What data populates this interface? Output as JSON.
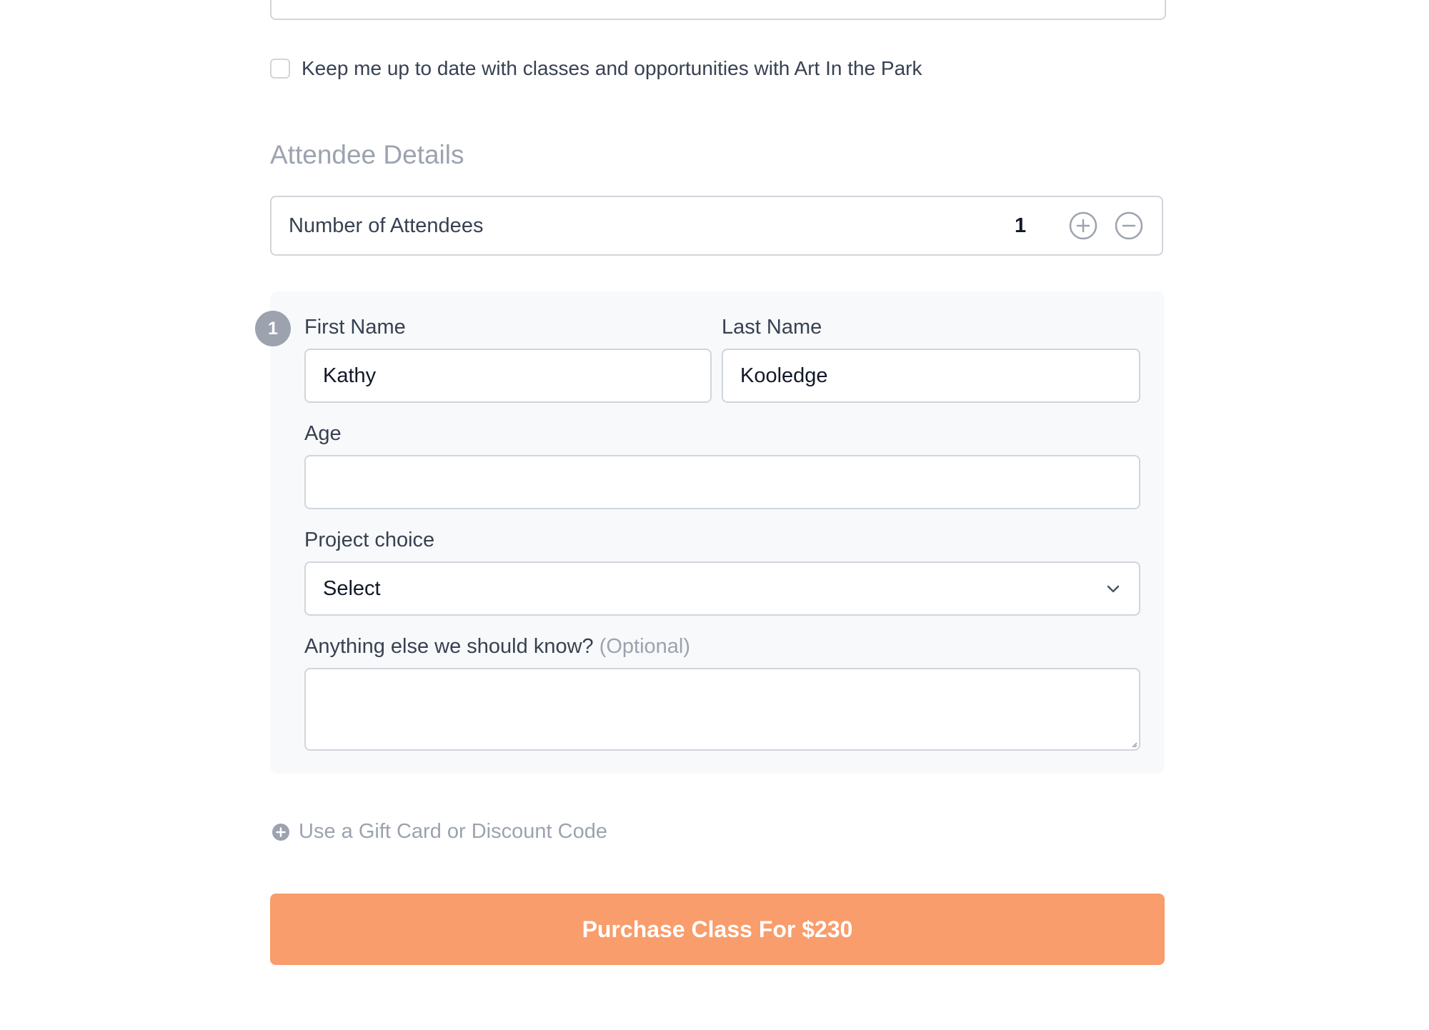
{
  "newsletter": {
    "label": "Keep me up to date with classes and opportunities with Art In the Park",
    "checked": false
  },
  "attendee_section": {
    "title": "Attendee Details",
    "count_label": "Number of Attendees",
    "count_value": "1",
    "increment_icon": "plus-circle-icon",
    "decrement_icon": "minus-circle-icon"
  },
  "attendee": {
    "number": "1",
    "first_name_label": "First Name",
    "first_name_value": "Kathy",
    "last_name_label": "Last Name",
    "last_name_value": "Kooledge",
    "age_label": "Age",
    "age_value": "",
    "project_label": "Project choice",
    "project_value": "Select",
    "notes_label": "Anything else we should know?",
    "notes_optional": "(Optional)",
    "notes_value": ""
  },
  "gift_card": {
    "label": "Use a Gift Card or Discount Code",
    "icon": "plus-circle-filled-icon"
  },
  "purchase": {
    "label": "Purchase Class For $230"
  },
  "colors": {
    "primary_button": "#f89d6b",
    "muted_text": "#9ca3af",
    "body_text": "#374151",
    "border": "#d1d5db",
    "card_background": "#f8f9fb"
  }
}
